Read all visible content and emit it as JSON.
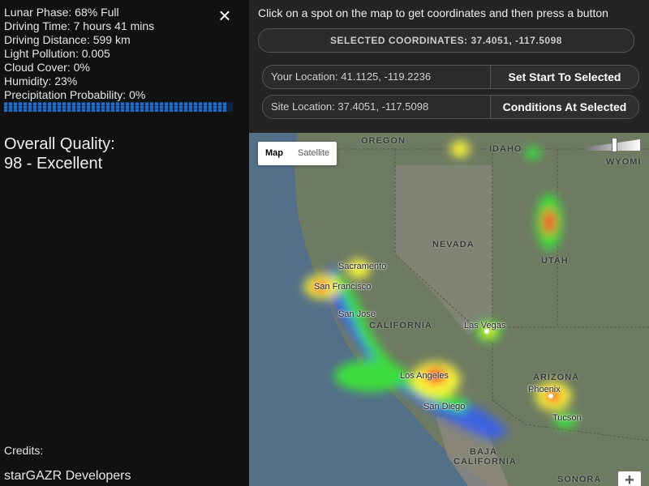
{
  "stats": {
    "lunar_phase": "Lunar Phase: 68% Full",
    "driving_time": "Driving Time: 7 hours 41 mins",
    "driving_distance": "Driving Distance: 599 km",
    "light_pollution": "Light Pollution: 0.005",
    "cloud_cover": "Cloud Cover: 0%",
    "humidity": "Humidity: 23%",
    "precipitation": "Precipitation Probability: 0%"
  },
  "quality": {
    "progress_fraction": 0.98,
    "label": "Overall Quality:",
    "value": "98 - Excellent"
  },
  "credits": {
    "label": "Credits:",
    "value": "starGAZR Developers"
  },
  "close_icon": "×",
  "instructions": "Click on a spot on the map to get coordinates and then press a button",
  "selected_coordinates": "SELECTED COORDINATES: 37.4051, -117.5098",
  "your_location": {
    "text": "Your Location: 41.1125, -119.2236",
    "button": "Set Start To Selected"
  },
  "site_location": {
    "text": "Site Location: 37.4051, -117.5098",
    "button": "Conditions At Selected"
  },
  "map": {
    "type_map": "Map",
    "type_satellite": "Satellite",
    "zoom_in": "+",
    "regions": {
      "oregon": "OREGON",
      "idaho": "IDAHO",
      "wyoming": "WYOMI",
      "nevada": "NEVADA",
      "utah": "UTAH",
      "california": "CALIFORNIA",
      "arizona": "ARIZONA",
      "baja": "BAJA",
      "baja_california": "CALIFORNIA",
      "sonora": "SONORA"
    },
    "cities": {
      "sacramento": "Sacramento",
      "san_francisco": "San Francisco",
      "san_jose": "San Jose",
      "las_vegas": "Las Vegas",
      "los_angeles": "Los Angeles",
      "san_diego": "San Diego",
      "phoenix": "Phoenix",
      "tucson": "Tucson"
    },
    "colors": {
      "ocean": "#546f88",
      "land": "#6f7a62",
      "heat_blue": "#2f5cff",
      "heat_green": "#3ddc3d",
      "heat_yellow": "#f5f53a",
      "heat_red": "#ff3a2a"
    }
  }
}
